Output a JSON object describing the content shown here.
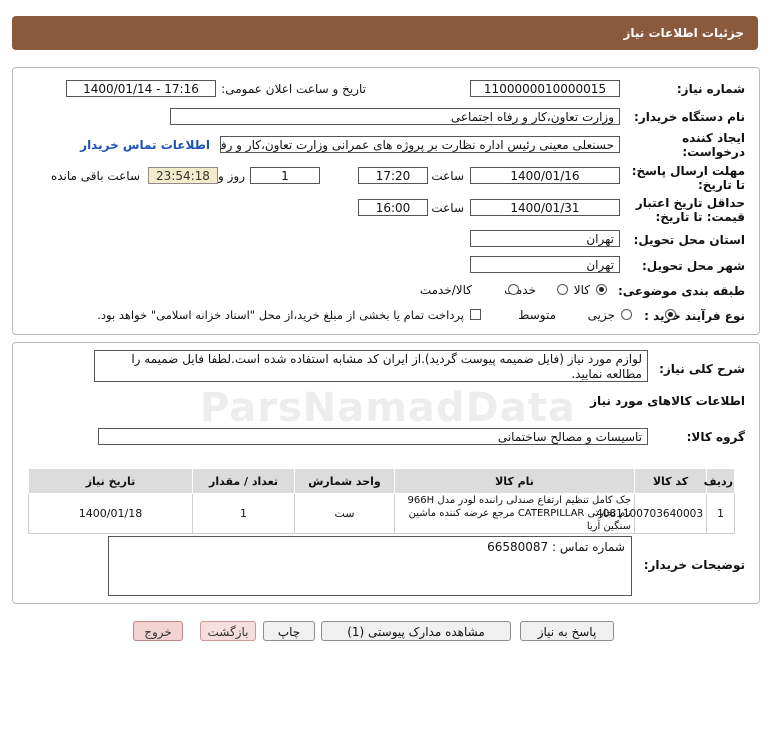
{
  "header": {
    "title": "جزئیات اطلاعات نیاز"
  },
  "info": {
    "need_number_label": "شماره نیاز:",
    "need_number": "1100000010000015",
    "announce_label": "تاریخ و ساعت اعلان عمومی:",
    "announce_value": "1400/01/14 - 17:16",
    "buyer_org_label": "نام دستگاه خریدار:",
    "buyer_org": "وزارت تعاون،کار و رفاه اجتماعی",
    "creator_label_1": "ایجاد کننده",
    "creator_label_2": "درخواست:",
    "creator": "حسنعلی معینی رئیس اداره نظارت بر پروژه های عمرانی وزارت تعاون،کار و رفاه ا",
    "contact_link": "اطلاعات تماس خریدار",
    "reply_label_1": "مهلت ارسال پاسخ:",
    "reply_label_2": "تا تاریخ:",
    "reply_date": "1400/01/16",
    "time_label": "ساعت",
    "reply_time": "17:20",
    "days_value": "1",
    "days_label": "روز و",
    "countdown": "23:54:18",
    "remaining_label": "ساعت باقی مانده",
    "validity_label_1": "حداقل تاریخ اعتبار",
    "validity_label_2": "قیمت: تا تاریخ:",
    "validity_date": "1400/01/31",
    "validity_time_label": "ساعت",
    "validity_time": "16:00",
    "province_label": "استان محل تحویل:",
    "province": "تهران",
    "city_label": "شهر محل تحویل:",
    "city": "تهران",
    "category_label": "طبقه بندی موضوعی:",
    "category_options": [
      "کالا",
      "خدمت",
      "کالا/خدمت"
    ],
    "process_label": "نوع فرآیند خرید :",
    "process_options": [
      "جزیی",
      "متوسط"
    ],
    "payment_note": "پرداخت تمام یا بخشی از مبلغ خرید،از محل \"اسناد خزانه اسلامی\" خواهد بود."
  },
  "details": {
    "desc_label": "شرح کلی نیاز:",
    "desc": "لوازم مورد نیاز (فایل ضمیمه پیوست گردید).از ایران کد مشابه استفاده شده است.لطفا فایل ضمیمه را مطالعه نمایید.",
    "goods_title": "اطلاعات کالاهای مورد نیاز",
    "group_label": "گروه کالا:",
    "group_value": "تاسیسات و مصالح ساختمانی",
    "columns": [
      "ردیف",
      "کد کالا",
      "نام کالا",
      "واحد شمارش",
      "تعداد / مقدار",
      "تاریخ نیاز"
    ],
    "rows": [
      {
        "row": "1",
        "code": "4081100703640003",
        "name": "جک کامل تنظیم ارتفاع صندلی راننده لودر مدل 966H نام تجارتی CATERPILLAR مرجع عرضه کننده ماشین سنگین آریا",
        "unit": "ست",
        "qty": "1",
        "date": "1400/01/18"
      }
    ],
    "buyer_notes_label": "توضیحات خریدار:",
    "buyer_notes": "شماره تماس : 66580087"
  },
  "buttons": {
    "reply": "پاسخ به نیاز",
    "view_docs": "مشاهده مدارک پیوستی (1)",
    "print": "چاپ",
    "back": "بازگشت",
    "exit": "خروج"
  },
  "watermark": "ParsNamadData"
}
